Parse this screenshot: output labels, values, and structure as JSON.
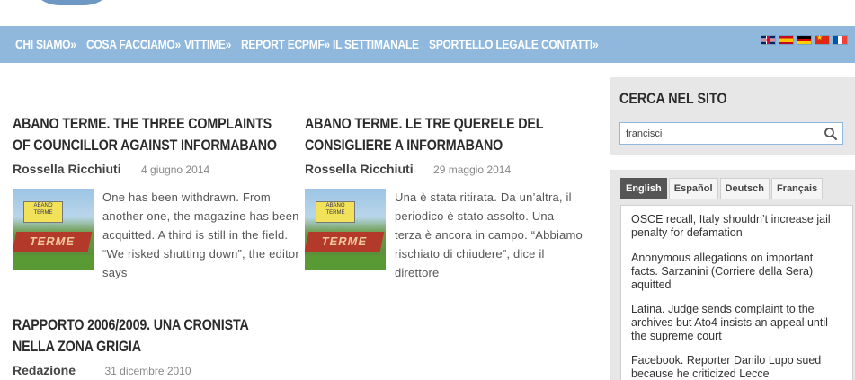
{
  "nav": {
    "items": [
      {
        "label": "CHI SIAMO»"
      },
      {
        "label": "COSA FACCIAMO»"
      },
      {
        "label": "VITTIME»"
      },
      {
        "label": "REPORT ECPMF»"
      },
      {
        "label": "IL SETTIMANALE"
      },
      {
        "label": "SPORTELLO LEGALE"
      },
      {
        "label": "CONTATTI»"
      }
    ],
    "flags": [
      "uk-flag-icon",
      "spain-flag-icon",
      "germany-flag-icon",
      "china-flag-icon",
      "france-flag-icon"
    ]
  },
  "articles": [
    {
      "title": "ABANO TERME. THE THREE COMPLAINTS OF COUNCILLOR AGAINST INFORMABANO",
      "author": "Rossella Ricchiuti",
      "date": "4 giugno 2014",
      "excerpt": "One has been withdrawn. From another one, the magazine has been acquitted. A third is still in the field. “We risked shutting down”, the editor says"
    },
    {
      "title": "ABANO TERME. LE TRE QUERELE DEL CONSIGLIERE A INFORMABANO",
      "author": "Rossella Ricchiuti",
      "date": "29 maggio 2014",
      "excerpt": "Una è stata ritirata. Da un’altra, il periodico è stato assolto. Una terza è ancora in campo. “Abbiamo rischiato di chiudere”, dice il direttore"
    },
    {
      "title": "RAPPORTO 2006/2009. UNA CRONISTA NELLA ZONA GRIGIA",
      "author": "Redazione",
      "date": "31 dicembre 2010"
    }
  ],
  "thumb": {
    "sign_text": "ABANO TERME",
    "bed_text": "TERME"
  },
  "sidebar": {
    "search_title": "CERCA NEL SITO",
    "search_value": "francisci",
    "lang_tabs": [
      "English",
      "Español",
      "Deutsch",
      "Français"
    ],
    "active_tab": "English",
    "links": [
      "OSCE recall, Italy shouldn’t increase jail penalty for defamation",
      "Anonymous allegations on important facts. Sarzanini (Corriere della Sera) aquitted",
      "Latina. Judge sends complaint to the archives but Ato4 insists an appeal until the supreme court",
      "Facebook. Reporter Danilo Lupo sued because he criticized Lecce"
    ]
  },
  "colors": {
    "nav_bg": "#8fb8dc",
    "sidebar_bg": "#e7e7e7",
    "active_tab": "#555555"
  }
}
